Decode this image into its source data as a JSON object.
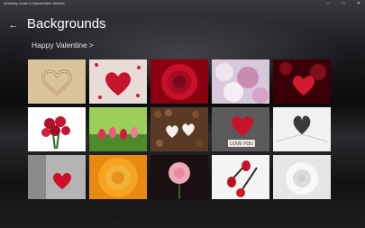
{
  "window": {
    "title": "Greeting Cards & Handwritten Wishes",
    "controls": [
      "minimize-icon",
      "maximize-icon",
      "close-icon"
    ]
  },
  "header": {
    "back_icon": "back-arrow-icon",
    "title": "Backgrounds"
  },
  "category": {
    "label": "Happy Valentine",
    "chevron": ">"
  },
  "tiles": [
    {
      "name": "heart drawn in sand"
    },
    {
      "name": "heart of red beads on white"
    },
    {
      "name": "red rose close-up"
    },
    {
      "name": "pink and white roses"
    },
    {
      "name": "red bokeh hearts"
    },
    {
      "name": "bouquet of red roses"
    },
    {
      "name": "red and pink tulips"
    },
    {
      "name": "coffee beans with hearts"
    },
    {
      "name": "knitted heart with love you tag"
    },
    {
      "name": "book pages folded into heart"
    },
    {
      "name": "red heart on black and white"
    },
    {
      "name": "orange rose"
    },
    {
      "name": "pink rose on dark background"
    },
    {
      "name": "red rose buds on white"
    },
    {
      "name": "white rose"
    }
  ],
  "tile_text": {
    "love_you": "LOVE YOU"
  }
}
